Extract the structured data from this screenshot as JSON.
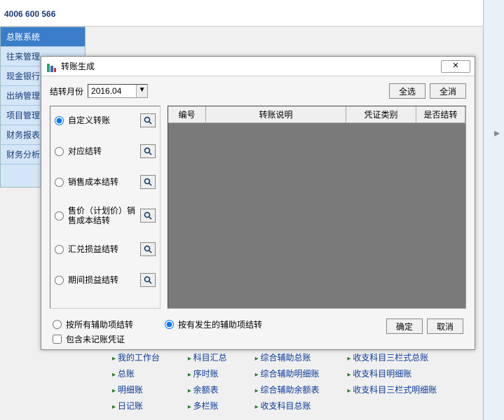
{
  "topbar": {
    "phone": "4006 600 566"
  },
  "sidebar": {
    "items": [
      {
        "label": "总账系统",
        "active": true
      },
      {
        "label": "往来管理"
      },
      {
        "label": "现金银行"
      },
      {
        "label": "出纳管理"
      },
      {
        "label": "项目管理"
      },
      {
        "label": "财务报表"
      },
      {
        "label": "财务分析"
      }
    ]
  },
  "dialog": {
    "title": "转账生成",
    "close": "✕",
    "month_label": "结转月份",
    "month_value": "2016.04",
    "select_all": "全选",
    "select_none": "全消",
    "radios": [
      "自定义转账",
      "对应结转",
      "销售成本结转",
      "售价（计划价）销售成本结转",
      "汇兑损益结转",
      "期间损益结转"
    ],
    "grid": {
      "h1": "编号",
      "h2": "转账说明",
      "h3": "凭证类别",
      "h4": "是否结转"
    },
    "opt_all_aux": "按所有辅助项结转",
    "opt_have_aux": "按有发生的辅助项结转",
    "opt_include_unposted": "包含未记账凭证",
    "ok": "确定",
    "cancel": "取消"
  },
  "bglinks": {
    "c1": [
      "我的工作台",
      "总账",
      "明细账",
      "日记账"
    ],
    "c2": [
      "科目汇总",
      "序时账",
      "余额表",
      "多栏账"
    ],
    "c3": [
      "综合辅助总账",
      "综合辅助明细账",
      "综合辅助余额表",
      "收支科目总账"
    ],
    "c4": [
      "收支科目三栏式总账",
      "收支科目明细账",
      "收支科目三栏式明细账"
    ]
  }
}
